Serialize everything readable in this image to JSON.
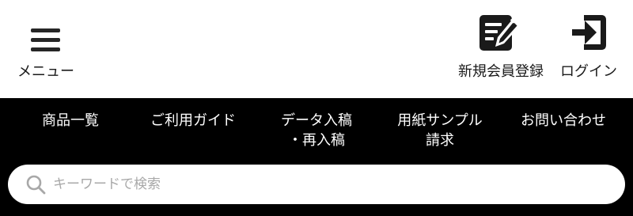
{
  "header": {
    "menu": {
      "label": "メニュー",
      "icon": "hamburger-menu-icon"
    },
    "register": {
      "label": "新規会員登録",
      "icon": "edit-document-icon"
    },
    "login": {
      "label": "ログイン",
      "icon": "login-arrow-icon"
    }
  },
  "nav": {
    "items": [
      {
        "lines": [
          "商品一覧"
        ]
      },
      {
        "lines": [
          "ご利用ガイド"
        ]
      },
      {
        "lines": [
          "データ入稿",
          "・再入稿"
        ]
      },
      {
        "lines": [
          "用紙サンプル",
          "請求"
        ]
      },
      {
        "lines": [
          "お問い合わせ"
        ]
      }
    ]
  },
  "search": {
    "placeholder": "キーワードで検索",
    "value": "",
    "icon": "search-icon"
  },
  "colors": {
    "nav_background": "#000000",
    "header_background": "#ffffff",
    "icon_color": "#1a1a1a",
    "placeholder_color": "#a8a8a8"
  }
}
